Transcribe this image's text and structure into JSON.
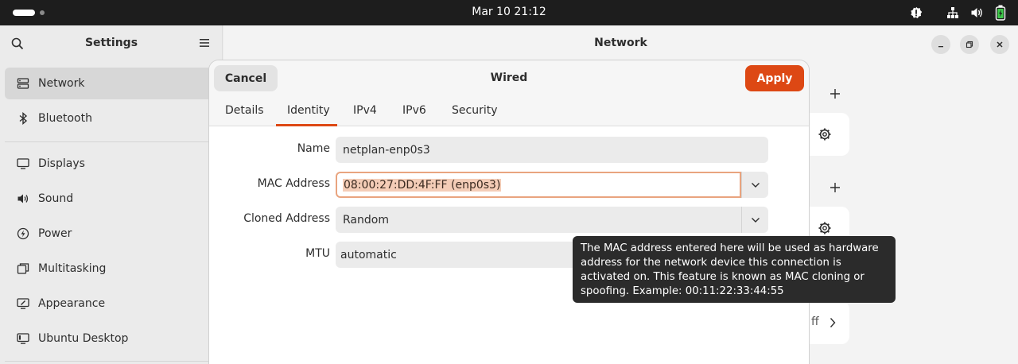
{
  "topbar": {
    "datetime": "Mar 10  21:12"
  },
  "sidebar": {
    "title": "Settings",
    "items": [
      {
        "label": "Network",
        "icon": "network-icon"
      },
      {
        "label": "Bluetooth",
        "icon": "bluetooth-icon"
      },
      {
        "label": "Displays",
        "icon": "display-icon"
      },
      {
        "label": "Sound",
        "icon": "sound-icon"
      },
      {
        "label": "Power",
        "icon": "power-icon"
      },
      {
        "label": "Multitasking",
        "icon": "multitasking-icon"
      },
      {
        "label": "Appearance",
        "icon": "appearance-icon"
      },
      {
        "label": "Ubuntu Desktop",
        "icon": "ubuntu-desktop-icon"
      }
    ]
  },
  "main": {
    "title": "Network",
    "partial_text": "ff"
  },
  "dialog": {
    "title": "Wired",
    "cancel_label": "Cancel",
    "apply_label": "Apply",
    "tabs": [
      "Details",
      "Identity",
      "IPv4",
      "IPv6",
      "Security"
    ],
    "active_tab": "Identity",
    "fields": {
      "name_label": "Name",
      "name_value": "netplan-enp0s3",
      "mac_label": "MAC Address",
      "mac_value": "08:00:27:DD:4F:FF (enp0s3)",
      "cloned_label": "Cloned Address",
      "cloned_value": "Random",
      "mtu_label": "MTU",
      "mtu_value": "automatic"
    },
    "tooltip": "The MAC address entered here will be used as hardware address for the network device this connection is activated on. This feature is known as MAC cloning or spoofing. Example: 00:11:22:33:44:55"
  },
  "colors": {
    "accent": "#dd4814",
    "topbar": "#1d1d1d",
    "tooltip_bg": "#2b2b2b"
  }
}
